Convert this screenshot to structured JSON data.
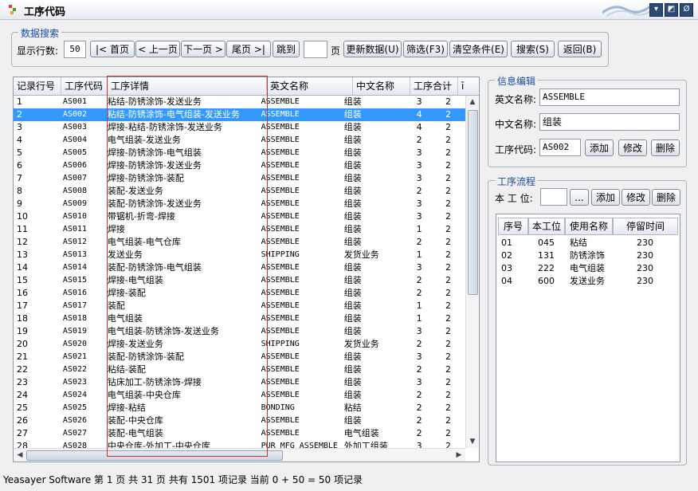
{
  "window": {
    "title": "工序代码",
    "controls": [
      "▾",
      "◩",
      "Ø"
    ]
  },
  "search": {
    "legend": "数据搜索",
    "rows_label": "显示行数:",
    "rows_value": "50",
    "first": "|< 首页",
    "prev": "< 上一页",
    "next": "下一页 >",
    "last": "尾页 >|",
    "jump": "跳到",
    "jump_value": "",
    "page_label": "页",
    "refresh": "更新数据(U)",
    "filter": "筛选(F3)",
    "clear": "清空条件(E)",
    "find": "搜索(S)",
    "back": "返回(B)"
  },
  "grid": {
    "headers": [
      "记录行号",
      "工序代码",
      "工序详情",
      "英文名称",
      "中文名称",
      "工序合计",
      "ī"
    ],
    "rows": [
      [
        "1",
        "AS001",
        "粘结-防锈涂饰-发送业务",
        "ASSEMBLE",
        "组装",
        "3",
        "2"
      ],
      [
        "2",
        "AS002",
        "粘结-防锈涂饰-电气组装-发送业务",
        "ASSEMBLE",
        "组装",
        "4",
        "2"
      ],
      [
        "3",
        "AS003",
        "焊接-粘结-防锈涂饰-发送业务",
        "ASSEMBLE",
        "组装",
        "4",
        "2"
      ],
      [
        "4",
        "AS004",
        "电气组装-发送业务",
        "ASSEMBLE",
        "组装",
        "2",
        "2"
      ],
      [
        "5",
        "AS005",
        "焊接-防锈涂饰-电气组装",
        "ASSEMBLE",
        "组装",
        "3",
        "2"
      ],
      [
        "6",
        "AS006",
        "焊接-防锈涂饰-发送业务",
        "ASSEMBLE",
        "组装",
        "3",
        "2"
      ],
      [
        "7",
        "AS007",
        "焊接-防锈涂饰-装配",
        "ASSEMBLE",
        "组装",
        "3",
        "2"
      ],
      [
        "8",
        "AS008",
        "装配-发送业务",
        "ASSEMBLE",
        "组装",
        "2",
        "2"
      ],
      [
        "9",
        "AS009",
        "装配-防锈涂饰-发送业务",
        "ASSEMBLE",
        "组装",
        "3",
        "2"
      ],
      [
        "10",
        "AS010",
        "带锯机-折弯-焊接",
        "ASSEMBLE",
        "组装",
        "3",
        "2"
      ],
      [
        "11",
        "AS011",
        "焊接",
        "ASSEMBLE",
        "组装",
        "1",
        "2"
      ],
      [
        "12",
        "AS012",
        "电气组装-电气仓库",
        "ASSEMBLE",
        "组装",
        "2",
        "2"
      ],
      [
        "13",
        "AS013",
        "发送业务",
        "SHIPPING",
        "发货业务",
        "1",
        "2"
      ],
      [
        "14",
        "AS014",
        "装配-防锈涂饰-电气组装",
        "ASSEMBLE",
        "组装",
        "3",
        "2"
      ],
      [
        "15",
        "AS015",
        "焊接-电气组装",
        "ASSEMBLE",
        "组装",
        "2",
        "2"
      ],
      [
        "16",
        "AS016",
        "焊接-装配",
        "ASSEMBLE",
        "组装",
        "2",
        "2"
      ],
      [
        "17",
        "AS017",
        "装配",
        "ASSEMBLE",
        "组装",
        "1",
        "2"
      ],
      [
        "18",
        "AS018",
        "电气组装",
        "ASSEMBLE",
        "组装",
        "1",
        "2"
      ],
      [
        "19",
        "AS019",
        "电气组装-防锈涂饰-发送业务",
        "ASSEMBLE",
        "组装",
        "3",
        "2"
      ],
      [
        "20",
        "AS020",
        "焊接-发送业务",
        "SHIPPING",
        "发货业务",
        "2",
        "2"
      ],
      [
        "21",
        "AS021",
        "装配-防锈涂饰-装配",
        "ASSEMBLE",
        "组装",
        "3",
        "2"
      ],
      [
        "22",
        "AS022",
        "粘结-装配",
        "ASSEMBLE",
        "组装",
        "2",
        "2"
      ],
      [
        "23",
        "AS023",
        "钻床加工-防锈涂饰-焊接",
        "ASSEMBLE",
        "组装",
        "3",
        "2"
      ],
      [
        "24",
        "AS024",
        "电气组装-中央仓库",
        "ASSEMBLE",
        "组装",
        "2",
        "2"
      ],
      [
        "25",
        "AS025",
        "焊接-粘结",
        "BONDING",
        "粘结",
        "2",
        "2"
      ],
      [
        "26",
        "AS026",
        "装配-中央仓库",
        "ASSEMBLE",
        "组装",
        "2",
        "2"
      ],
      [
        "27",
        "AS027",
        "装配-电气组装",
        "ASSEMBLE",
        "电气组装",
        "2",
        "2"
      ],
      [
        "28",
        "AS028",
        "中央仓库-外加工-中央仓库",
        "PUR_MFG_ASSEMBLE",
        "外加工组装",
        "3",
        "2"
      ]
    ]
  },
  "info": {
    "legend": "信息编辑",
    "en_label": "英文名称:",
    "en_value": "ASSEMBLE",
    "cn_label": "中文名称:",
    "cn_value": "组装",
    "code_label": "工序代码:",
    "code_value": "AS002",
    "add": "添加",
    "edit": "修改",
    "delete": "删除"
  },
  "flow": {
    "legend": "工序流程",
    "station_label": "本 工 位:",
    "station_value": "",
    "browse": "...",
    "add": "添加",
    "edit": "修改",
    "delete": "删除",
    "headers": [
      "序号",
      "本工位",
      "使用名称",
      "停留时间"
    ],
    "rows": [
      [
        "01",
        "045",
        "粘结",
        "230"
      ],
      [
        "02",
        "131",
        "防锈涂饰",
        "230"
      ],
      [
        "03",
        "222",
        "电气组装",
        "230"
      ],
      [
        "04",
        "600",
        "发送业务",
        "230"
      ]
    ]
  },
  "status": "Yeasayer Software 第 1 页 共 31 页 共有 1501 项记录 当前 0 + 50 = 50 项记录",
  "colors": {
    "selection": "#3399ff",
    "legend": "#1c4aa8",
    "highlight": "#d23030"
  }
}
